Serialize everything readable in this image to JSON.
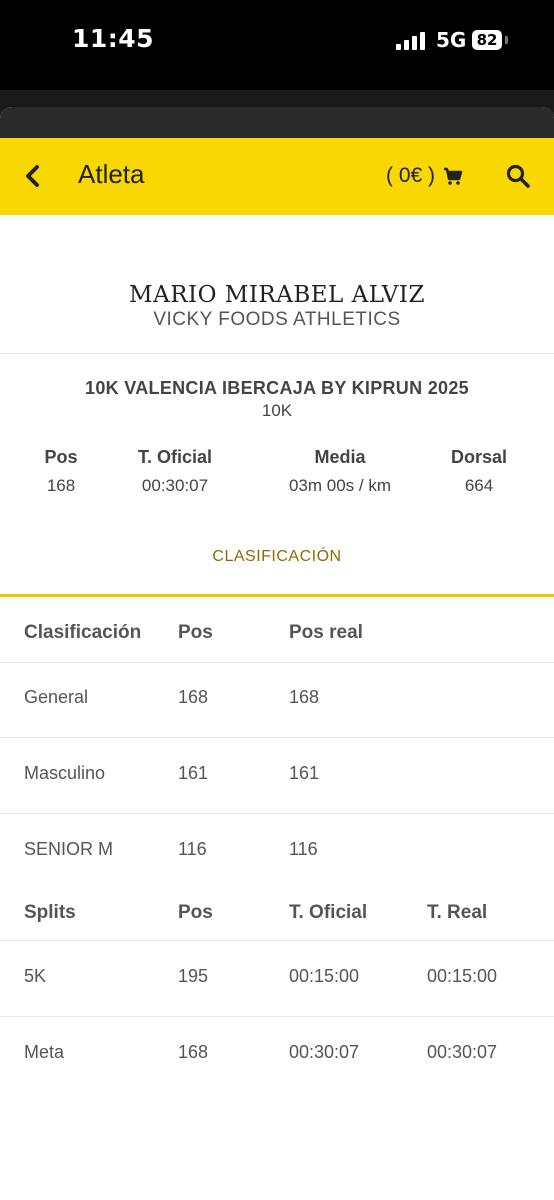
{
  "status_bar": {
    "time": "11:45",
    "network": "5G",
    "battery": "82"
  },
  "app_bar": {
    "title": "Atleta",
    "cart_label": "( 0€ )"
  },
  "athlete": {
    "name": "MARIO MIRABEL ALVIZ",
    "club": "VICKY FOODS ATHLETICS"
  },
  "race": {
    "name": "10K VALENCIA IBERCAJA BY KIPRUN 2025",
    "distance": "10K"
  },
  "stats": [
    {
      "label": "Pos",
      "value": "168"
    },
    {
      "label": "T. Oficial",
      "value": "00:30:07"
    },
    {
      "label": "Media",
      "value": "03m 00s / km"
    },
    {
      "label": "Dorsal",
      "value": "664"
    }
  ],
  "tab": {
    "label": "CLASIFICACIÓN"
  },
  "classification": {
    "headers": [
      "Clasificación",
      "Pos",
      "Pos real"
    ],
    "rows": [
      [
        "General",
        "168",
        "168"
      ],
      [
        "Masculino",
        "161",
        "161"
      ],
      [
        "SENIOR M",
        "116",
        "116"
      ]
    ]
  },
  "splits": {
    "headers": [
      "Splits",
      "Pos",
      "T. Oficial",
      "T. Real"
    ],
    "rows": [
      [
        "5K",
        "195",
        "00:15:00",
        "00:15:00"
      ],
      [
        "Meta",
        "168",
        "00:30:07",
        "00:30:07"
      ]
    ]
  }
}
